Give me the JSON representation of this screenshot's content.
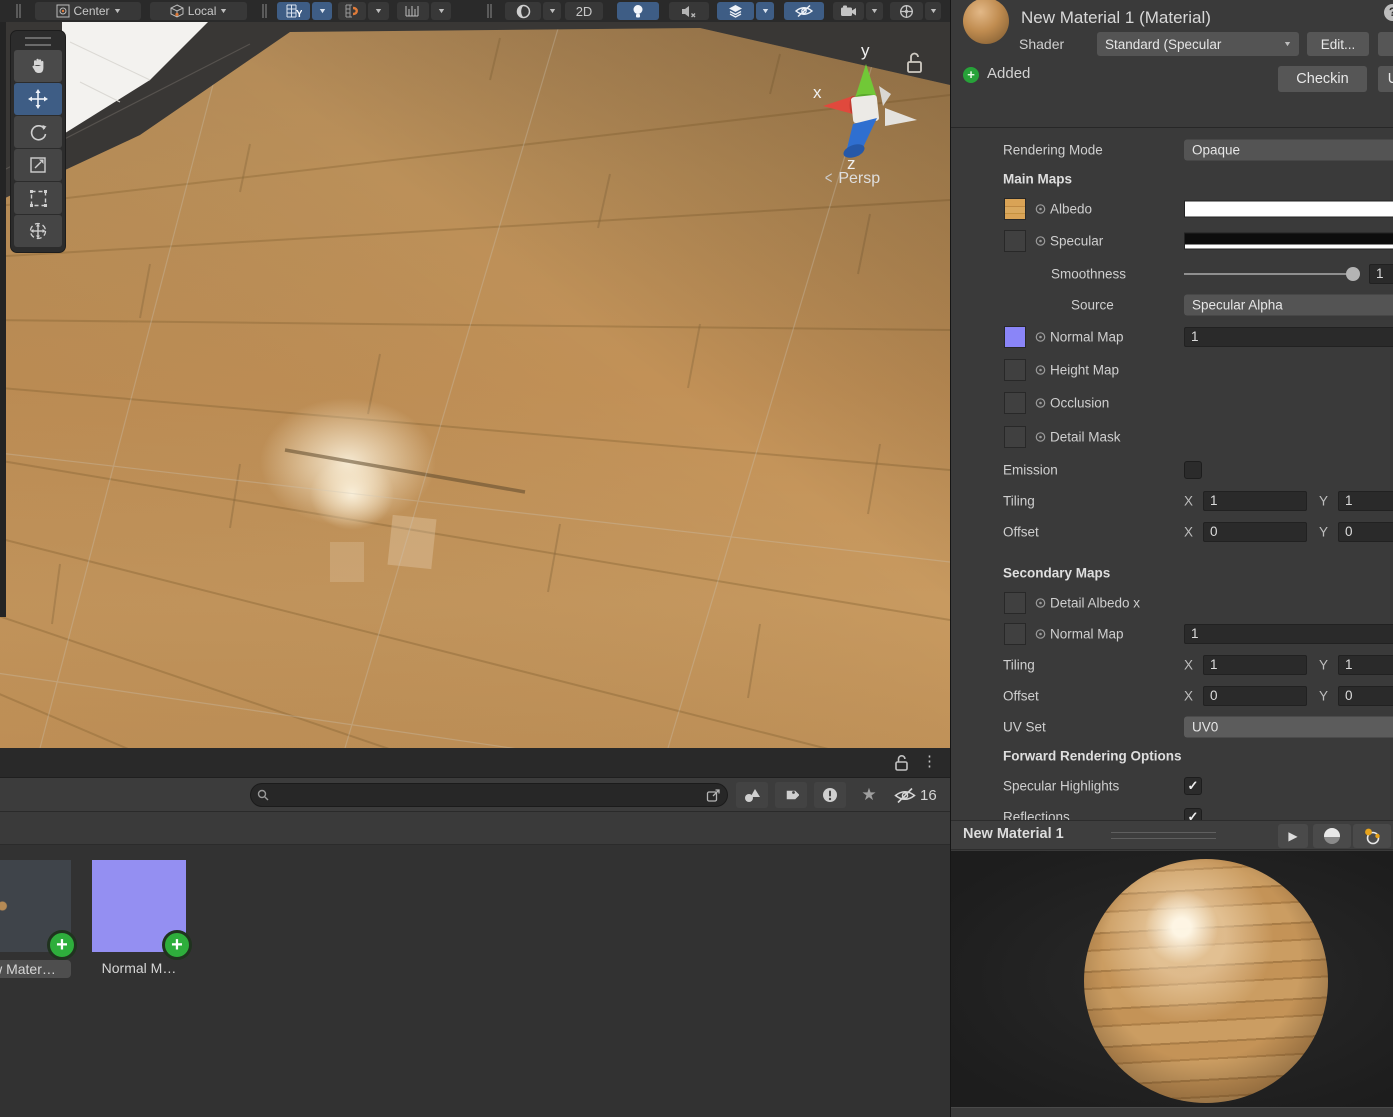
{
  "glyphs": {
    "check": "✓",
    "dropdown_arrow": "▼",
    "kebab": "⋮",
    "play": "▶",
    "star": "★",
    "persp_chevron": "<",
    "help": "?",
    "plus": "+",
    "exclaim": "!"
  },
  "colors": {
    "accent_blue": "#3e5d85",
    "normal_map_purple": "#8a85f8",
    "wood_tan": "#c49760",
    "added_green": "#2eae3c",
    "inspector_bg": "#3a3a3a"
  },
  "scene_toolbar": {
    "center_label": "Center",
    "local_label": "Local",
    "grid_axis_label": "Y",
    "mode_2d_label": "2D"
  },
  "scene": {
    "persp_label": "Persp",
    "axis_x": "x",
    "axis_y": "y",
    "axis_z": "z"
  },
  "project": {
    "search_value": "",
    "hidden_count": "16",
    "assets": [
      {
        "label": "w Mater…"
      },
      {
        "label": "Normal M…"
      }
    ]
  },
  "inspector": {
    "title": "New Material 1 (Material)",
    "shader_label": "Shader",
    "shader_value": "Standard (Specular",
    "edit_button": "Edit...",
    "vc_status": "Added",
    "checkin_button": "Checkin",
    "update_button": "U",
    "rendering_mode": {
      "label": "Rendering Mode",
      "value": "Opaque"
    },
    "main_maps_header": "Main Maps",
    "albedo": {
      "label": "Albedo"
    },
    "specular": {
      "label": "Specular"
    },
    "smoothness": {
      "label": "Smoothness",
      "value": "1"
    },
    "source": {
      "label": "Source",
      "value": "Specular Alpha"
    },
    "normal_map": {
      "label": "Normal Map",
      "value": "1"
    },
    "height_map": {
      "label": "Height Map"
    },
    "occlusion": {
      "label": "Occlusion"
    },
    "detail_mask": {
      "label": "Detail Mask"
    },
    "emission": {
      "label": "Emission",
      "checked": false
    },
    "tiling": {
      "label": "Tiling",
      "x_label": "X",
      "x": "1",
      "y_label": "Y",
      "y": "1"
    },
    "offset": {
      "label": "Offset",
      "x_label": "X",
      "x": "0",
      "y_label": "Y",
      "y": "0"
    },
    "secondary_maps_header": "Secondary Maps",
    "detail_albedo": {
      "label": "Detail Albedo x"
    },
    "secondary_normal_map": {
      "label": "Normal Map",
      "value": "1"
    },
    "secondary_tiling": {
      "label": "Tiling",
      "x_label": "X",
      "x": "1",
      "y_label": "Y",
      "y": "1"
    },
    "secondary_offset": {
      "label": "Offset",
      "x_label": "X",
      "x": "0",
      "y_label": "Y",
      "y": "0"
    },
    "uv_set": {
      "label": "UV Set",
      "value": "UV0"
    },
    "forward_header": "Forward Rendering Options",
    "specular_highlights": {
      "label": "Specular Highlights",
      "checked": true
    },
    "reflections": {
      "label": "Reflections",
      "checked": true
    },
    "preview": {
      "title": "New Material 1"
    }
  }
}
